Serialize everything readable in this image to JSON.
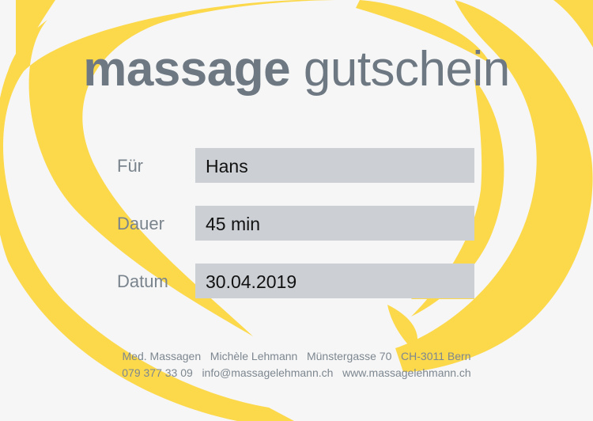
{
  "voucher": {
    "title_bold": "massage",
    "title_light": "gutschein",
    "fields": [
      {
        "label": "Für",
        "value": "Hans"
      },
      {
        "label": "Dauer",
        "value": "45 min"
      },
      {
        "label": "Datum",
        "value": "30.04.2019"
      }
    ],
    "footer_line1": "Med. Massagen   Michèle Lehmann   Münstergasse 70   CH-3011 Bern",
    "footer_line2": "079 377 33 09   info@massagelehmann.ch   www.massagelehmann.ch"
  },
  "colors": {
    "brush_yellow": "#fcd84b",
    "title_gray": "#6d7882",
    "field_bg": "#ccd0d4"
  }
}
